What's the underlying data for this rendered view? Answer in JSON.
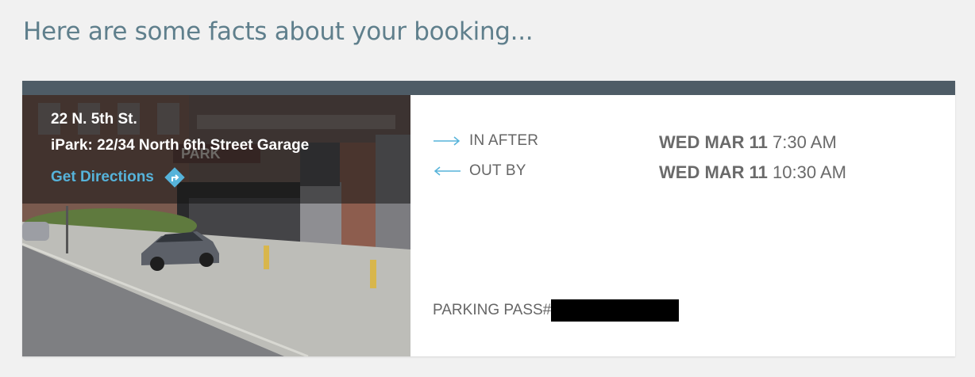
{
  "page": {
    "title": "Here are some facts about your booking..."
  },
  "location": {
    "address": "22 N. 5th St.",
    "garage": "iPark: 22/34 North 6th Street Garage",
    "directions_label": "Get Directions",
    "directions_icon": "directions-turn-icon"
  },
  "times": {
    "in": {
      "label": "IN AFTER",
      "day": "WED MAR 11",
      "time": "7:30 AM",
      "icon": "arrow-right-icon"
    },
    "out": {
      "label": "OUT BY",
      "day": "WED MAR 11",
      "time": "10:30 AM",
      "icon": "arrow-left-icon"
    }
  },
  "pass": {
    "label": "PARKING PASS#",
    "value_redacted": true
  },
  "colors": {
    "title": "#5f7f8c",
    "card_bar": "#4e5c66",
    "link": "#56b3da",
    "text": "#666666"
  }
}
